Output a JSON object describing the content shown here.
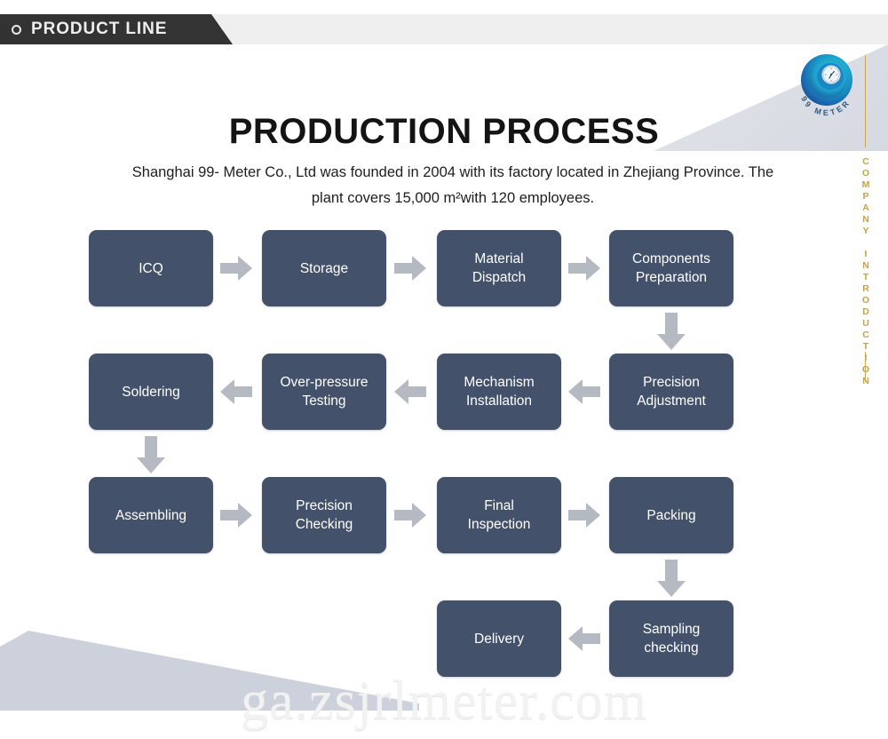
{
  "banner": {
    "label": "PRODUCT LINE",
    "icon": "ring-icon"
  },
  "logo": {
    "brand": "99 METER",
    "mark": "spiral-meter-icon"
  },
  "sidebar": {
    "vertical_label": "COMPANY INTRODUCTION",
    "rule_color": "#c9a84c"
  },
  "header": {
    "title": "PRODUCTION PROCESS",
    "subtitle": "Shanghai 99- Meter Co., Ltd was founded in 2004 with its factory located in Zhejiang Province. The plant covers 15,000 m²with 120 employees."
  },
  "colors": {
    "box_fill": "#44516a",
    "box_text": "#ffffff",
    "arrow_fill": "#b4b9c2",
    "banner_dark": "#333333",
    "banner_light": "#efefef",
    "wedge": "#ccd1dc",
    "gold": "#c9a84c"
  },
  "flow": {
    "rows": [
      {
        "direction": "left-to-right",
        "steps": [
          "ICQ",
          "Storage",
          "Material\nDispatch",
          "Components\nPreparation"
        ]
      },
      {
        "direction": "right-to-left",
        "steps": [
          "Soldering",
          "Over-pressure\nTesting",
          "Mechanism\nInstallation",
          "Precision\nAdjustment"
        ]
      },
      {
        "direction": "left-to-right",
        "steps": [
          "Assembling",
          "Precision\nChecking",
          "Final\nInspection",
          "Packing"
        ]
      },
      {
        "direction": "right-to-left",
        "steps": [
          "Delivery",
          "Sampling\nchecking"
        ]
      }
    ],
    "steps": {
      "icq": "ICQ",
      "storage": "Storage",
      "material_dispatch": "Material\nDispatch",
      "components_preparation": "Components\nPreparation",
      "precision_adjustment": "Precision\nAdjustment",
      "mechanism_installation": "Mechanism\nInstallation",
      "over_pressure_testing": "Over-pressure\nTesting",
      "soldering": "Soldering",
      "assembling": "Assembling",
      "precision_checking": "Precision\nChecking",
      "final_inspection": "Final\nInspection",
      "packing": "Packing",
      "sampling_checking": "Sampling\nchecking",
      "delivery": "Delivery"
    }
  },
  "watermark": {
    "text": "ga.zsjrlmeter.com"
  }
}
